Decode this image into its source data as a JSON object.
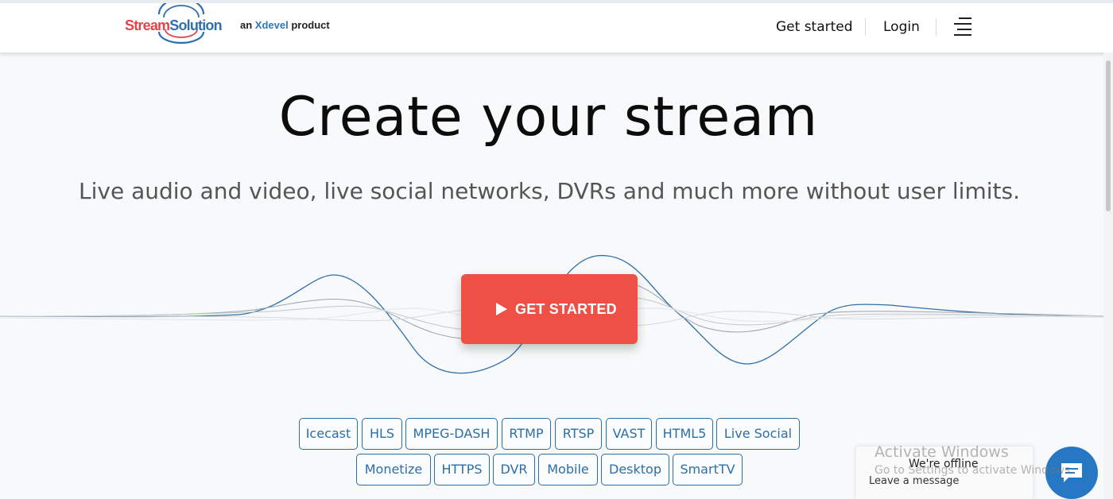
{
  "header": {
    "logo": {
      "part1": "Stream",
      "part2": "Solution"
    },
    "tagline": {
      "prefix": "an",
      "brand": "Xdevel",
      "suffix": "product"
    },
    "nav": {
      "get_started": "Get started",
      "login": "Login"
    },
    "menu_icon": "hamburger-menu-icon"
  },
  "hero": {
    "title": "Create your stream",
    "subtitle": "Live audio and video, live social networks, DVRs and much more without user limits.",
    "cta": {
      "label": "GET STARTED",
      "icon": "play-icon",
      "color": "#ef5046"
    }
  },
  "tags": {
    "row1": [
      "Icecast",
      "HLS",
      "MPEG-DASH",
      "RTMP",
      "RTSP",
      "VAST",
      "HTML5",
      "Live Social"
    ],
    "row2": [
      "Monetize",
      "HTTPS",
      "DVR",
      "Mobile",
      "Desktop",
      "SmartTV"
    ]
  },
  "chat": {
    "title": "We're offline",
    "subtitle": "Leave a message",
    "icon": "chat-bubble-icon",
    "color": "#2677c4"
  },
  "watermark": {
    "line1": "Activate Windows",
    "line2": "Go to Settings to activate Windows."
  },
  "colors": {
    "accent": "#ef5046",
    "link_blue": "#2c6ea5",
    "wave_blue": "#2f6fae"
  }
}
